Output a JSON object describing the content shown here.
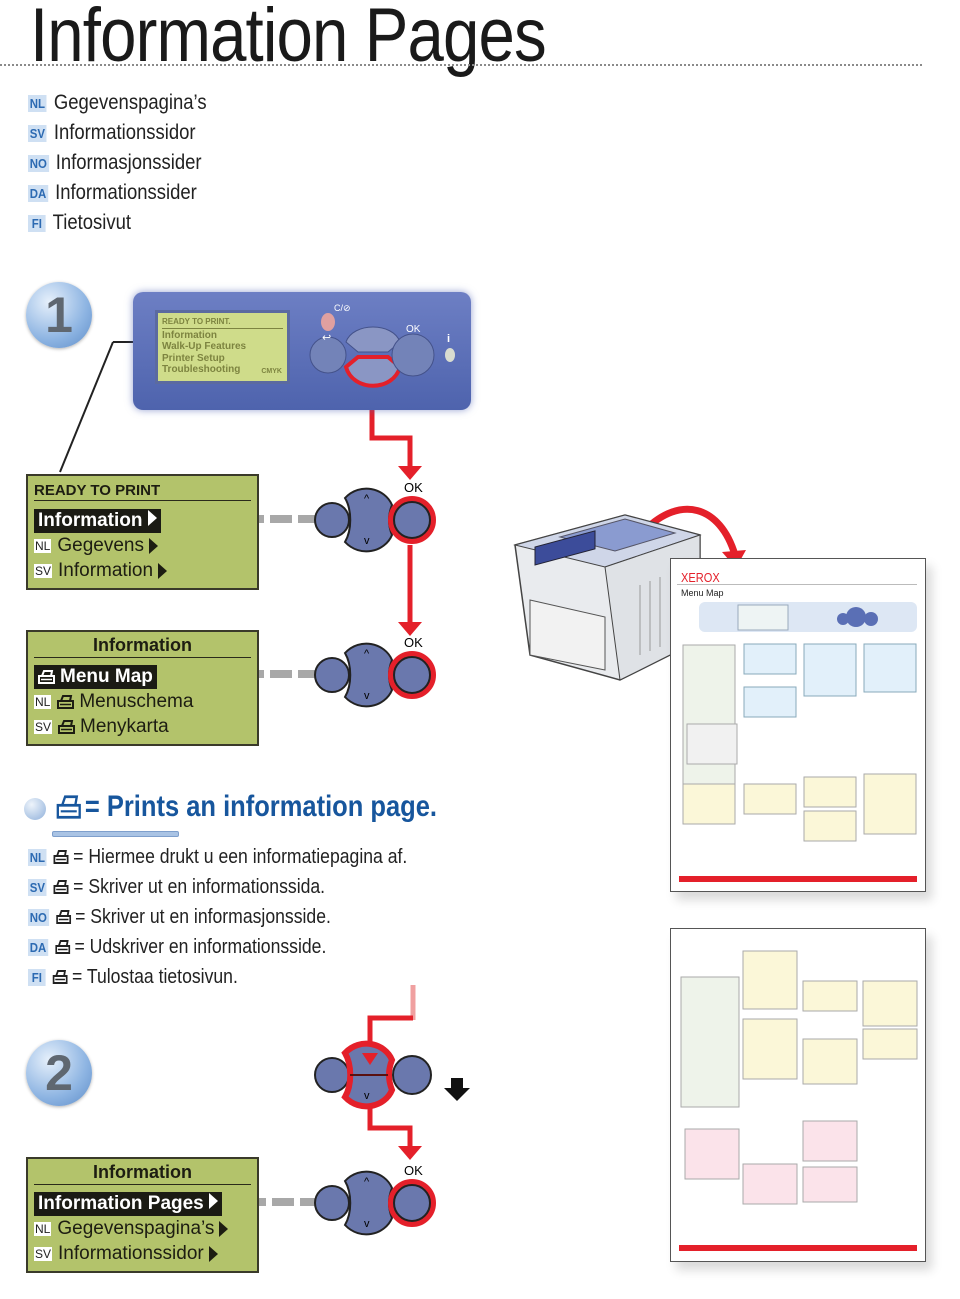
{
  "title": "Information Pages",
  "languages": [
    {
      "code": "NL",
      "text": "Gegevenspagina’s"
    },
    {
      "code": "SV",
      "text": "Informationssidor"
    },
    {
      "code": "NO",
      "text": "Informasjonssider"
    },
    {
      "code": "DA",
      "text": "Informationssider"
    },
    {
      "code": "FI",
      "text": "Tietosivut"
    }
  ],
  "steps": [
    "1",
    "2"
  ],
  "panel": {
    "lcd_header": "READY TO PRINT.",
    "lcd_items": [
      "Information",
      "Walk-Up Features",
      "Printer Setup",
      "Troubleshooting"
    ],
    "cmyk": "CMYK",
    "cancel_label": "C/⊘",
    "ok_label": "OK",
    "info_label": "i"
  },
  "screens": [
    {
      "header": "READY TO PRINT",
      "selected": "Information",
      "rows": [
        {
          "code": "NL",
          "text": "Gegevens"
        },
        {
          "code": "SV",
          "text": "Information"
        }
      ]
    },
    {
      "header": "Information",
      "selected": "Menu Map",
      "rows": [
        {
          "code": "NL",
          "text": "Menuschema"
        },
        {
          "code": "SV",
          "text": "Menykarta"
        }
      ]
    },
    {
      "header": "Information",
      "selected": "Information Pages",
      "rows": [
        {
          "code": "NL",
          "text": "Gegevenspagina’s"
        },
        {
          "code": "SV",
          "text": "Informationssidor"
        }
      ]
    }
  ],
  "ok_label": "OK",
  "heading": "= Prints an information page.",
  "descriptions": [
    {
      "code": "NL",
      "text": "= Hiermee drukt u een informatiepagina af."
    },
    {
      "code": "SV",
      "text": "= Skriver ut en informationssida."
    },
    {
      "code": "NO",
      "text": "= Skriver ut en informasjonsside."
    },
    {
      "code": "DA",
      "text": "= Udskriver en informationsside."
    },
    {
      "code": "FI",
      "text": "= Tulostaa tietosivun."
    }
  ],
  "menu_map": {
    "brand": "XEROX",
    "title": "Menu Map"
  },
  "colors": {
    "accent_red": "#e4202a",
    "heading_blue": "#17569d",
    "lcd_green": "#b3c36b",
    "button_blue": "#6a78ad"
  }
}
